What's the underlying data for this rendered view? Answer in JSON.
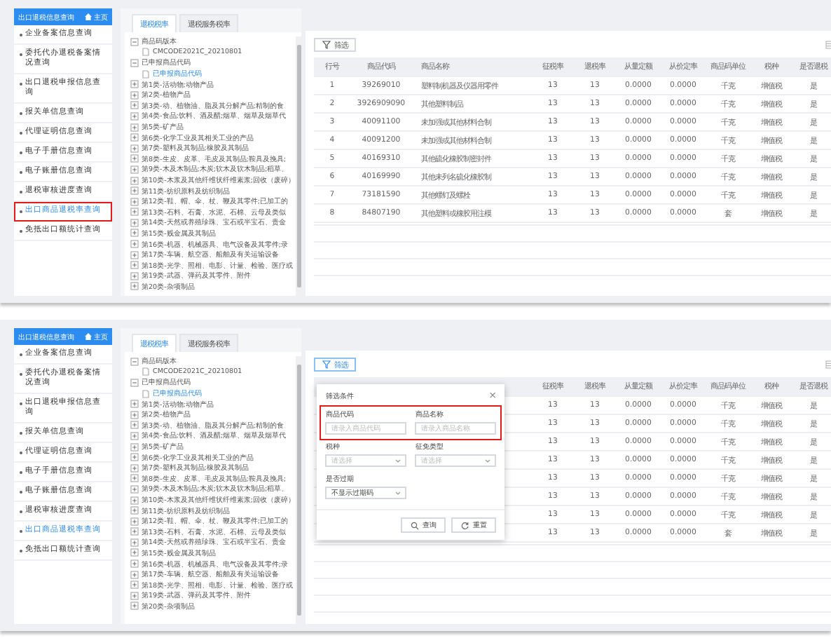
{
  "screens": [
    {
      "sidebar": {
        "title": "出口退税信息查询",
        "home_button": "主页",
        "items": [
          {
            "label": "企业备案信息查询",
            "selected": false,
            "highlighted": false
          },
          {
            "label": "委托代办退税备案情况查询",
            "selected": false,
            "highlighted": false
          },
          {
            "label": "出口退税申报信息查询",
            "selected": false,
            "highlighted": false
          },
          {
            "label": "报关单信息查询",
            "selected": false,
            "highlighted": false
          },
          {
            "label": "代理证明信息查询",
            "selected": false,
            "highlighted": false
          },
          {
            "label": "电子手册信息查询",
            "selected": false,
            "highlighted": false
          },
          {
            "label": "电子账册信息查询",
            "selected": false,
            "highlighted": false
          },
          {
            "label": "退税审核进度查询",
            "selected": false,
            "highlighted": false
          },
          {
            "label": "出口商品退税率查询",
            "selected": true,
            "highlighted": true
          },
          {
            "label": "免抵出口额统计查询",
            "selected": false,
            "highlighted": false
          }
        ]
      },
      "tabs": [
        {
          "label": "退税税率",
          "selected": true
        },
        {
          "label": "退税服务税率",
          "selected": false
        }
      ],
      "tree": [
        {
          "label": "商品码版本",
          "expanded": true,
          "selected": false,
          "children": [
            {
              "label": "CMCODE2021C_20210801",
              "selected": false
            }
          ]
        },
        {
          "label": "已申报商品代码",
          "expanded": true,
          "selected": false,
          "children": [
            {
              "label": "已申报商品代码",
              "selected": true
            }
          ]
        },
        {
          "label": "第1类-活动物;动物产品",
          "expanded": false,
          "selected": false
        },
        {
          "label": "第2类-植物产品",
          "expanded": false,
          "selected": false
        },
        {
          "label": "第3类-动、植物油、脂及其分解产品;精制的食",
          "expanded": false,
          "selected": false
        },
        {
          "label": "第4类-食品;饮料、酒及醋;烟草、烟草及烟草代",
          "expanded": false,
          "selected": false
        },
        {
          "label": "第5类-矿产品",
          "expanded": false,
          "selected": false
        },
        {
          "label": "第6类-化学工业及其相关工业的产品",
          "expanded": false,
          "selected": false
        },
        {
          "label": "第7类-塑料及其制品;橡胶及其制品",
          "expanded": false,
          "selected": false
        },
        {
          "label": "第8类-生皮、皮革、毛皮及其制品;鞍具及挽具;",
          "expanded": false,
          "selected": false
        },
        {
          "label": "第9类-木及木制品;木炭;软木及软木制品;稻草、",
          "expanded": false,
          "selected": false
        },
        {
          "label": "第10类-木浆及其他纤维状纤维素浆;回收（废碎）",
          "expanded": false,
          "selected": false
        },
        {
          "label": "第11类-纺织原料及纺织制品",
          "expanded": false,
          "selected": false
        },
        {
          "label": "第12类-鞋、帽、伞、杖、鞭及其零件;已加工的",
          "expanded": false,
          "selected": false
        },
        {
          "label": "第13类-石料、石膏、水泥、石棉、云母及类似",
          "expanded": false,
          "selected": false
        },
        {
          "label": "第14类-天然或养殖珍珠、宝石或半宝石、贵金",
          "expanded": false,
          "selected": false
        },
        {
          "label": "第15类-贱金属及其制品",
          "expanded": false,
          "selected": false
        },
        {
          "label": "第16类-机器、机械器具、电气设备及其零件;录",
          "expanded": false,
          "selected": false
        },
        {
          "label": "第17类-车辆、航空器、船舶及有关运输设备",
          "expanded": false,
          "selected": false
        },
        {
          "label": "第18类-光学、照相、电影、计量、检验、医疗或",
          "expanded": false,
          "selected": false
        },
        {
          "label": "第19类-武器、弹药及其零件、附件",
          "expanded": false,
          "selected": false
        },
        {
          "label": "第20类-杂项制品",
          "expanded": false,
          "selected": false
        }
      ],
      "filter_button": "筛选",
      "table": {
        "columns": [
          "行号",
          "商品代码",
          "商品名称",
          "征税率",
          "退税率",
          "从量定额",
          "从价定率",
          "商品码单位",
          "税种",
          "是否退税"
        ],
        "rows": [
          [
            "1",
            "39269010",
            "塑料制机器及仪器用零件",
            "13",
            "13",
            "0.0000",
            "0.0000",
            "千克",
            "增值税",
            "是"
          ],
          [
            "2",
            "3926909090",
            "其他塑料制品",
            "13",
            "13",
            "0.0000",
            "0.0000",
            "千克",
            "增值税",
            "是"
          ],
          [
            "3",
            "40091100",
            "未加强或其他材料合制",
            "13",
            "13",
            "0.0000",
            "0.0000",
            "千克",
            "增值税",
            "是"
          ],
          [
            "4",
            "40091200",
            "未加强或其他材料合制",
            "13",
            "13",
            "0.0000",
            "0.0000",
            "千克",
            "增值税",
            "是"
          ],
          [
            "5",
            "40169310",
            "其他硫化橡胶制密封件",
            "13",
            "13",
            "0.0000",
            "0.0000",
            "千克",
            "增值税",
            "是"
          ],
          [
            "6",
            "40169990",
            "其他未列名硫化橡胶制",
            "13",
            "13",
            "0.0000",
            "0.0000",
            "千克",
            "增值税",
            "是"
          ],
          [
            "7",
            "73181590",
            "其他螺钉及螺栓",
            "13",
            "13",
            "0.0000",
            "0.0000",
            "千克",
            "增值税",
            "是"
          ],
          [
            "8",
            "84807190",
            "其他塑料或橡胶用注模",
            "13",
            "13",
            "0.0000",
            "0.0000",
            "套",
            "增值税",
            "是"
          ]
        ]
      }
    },
    {
      "sidebar": {
        "title": "出口退税信息查询",
        "home_button": "主页",
        "items": [
          {
            "label": "企业备案信息查询",
            "selected": false,
            "highlighted": false
          },
          {
            "label": "委托代办退税备案情况查询",
            "selected": false,
            "highlighted": false
          },
          {
            "label": "出口退税申报信息查询",
            "selected": false,
            "highlighted": false
          },
          {
            "label": "报关单信息查询",
            "selected": false,
            "highlighted": false
          },
          {
            "label": "代理证明信息查询",
            "selected": false,
            "highlighted": false
          },
          {
            "label": "电子手册信息查询",
            "selected": false,
            "highlighted": false
          },
          {
            "label": "电子账册信息查询",
            "selected": false,
            "highlighted": false
          },
          {
            "label": "退税审核进度查询",
            "selected": false,
            "highlighted": false
          },
          {
            "label": "出口商品退税率查询",
            "selected": true,
            "highlighted": false
          },
          {
            "label": "免抵出口额统计查询",
            "selected": false,
            "highlighted": false
          }
        ]
      },
      "tabs": [
        {
          "label": "退税税率",
          "selected": true
        },
        {
          "label": "退税服务税率",
          "selected": false
        }
      ],
      "tree": [
        {
          "label": "商品码版本",
          "expanded": true,
          "selected": false,
          "children": [
            {
              "label": "CMCODE2021C_20210801",
              "selected": false
            }
          ]
        },
        {
          "label": "已申报商品代码",
          "expanded": true,
          "selected": false,
          "children": [
            {
              "label": "已申报商品代码",
              "selected": true
            }
          ]
        },
        {
          "label": "第1类-活动物;动物产品",
          "expanded": false,
          "selected": false
        },
        {
          "label": "第2类-植物产品",
          "expanded": false,
          "selected": false
        },
        {
          "label": "第3类-动、植物油、脂及其分解产品;精制的食",
          "expanded": false,
          "selected": false
        },
        {
          "label": "第4类-食品;饮料、酒及醋;烟草、烟草及烟草代",
          "expanded": false,
          "selected": false
        },
        {
          "label": "第5类-矿产品",
          "expanded": false,
          "selected": false
        },
        {
          "label": "第6类-化学工业及其相关工业的产品",
          "expanded": false,
          "selected": false
        },
        {
          "label": "第7类-塑料及其制品;橡胶及其制品",
          "expanded": false,
          "selected": false
        },
        {
          "label": "第8类-生皮、皮革、毛皮及其制品;鞍具及挽具;",
          "expanded": false,
          "selected": false
        },
        {
          "label": "第9类-木及木制品;木炭;软木及软木制品;稻草、",
          "expanded": false,
          "selected": false
        },
        {
          "label": "第10类-木浆及其他纤维状纤维素浆;回收（废碎）",
          "expanded": false,
          "selected": false
        },
        {
          "label": "第11类-纺织原料及纺织制品",
          "expanded": false,
          "selected": false
        },
        {
          "label": "第12类-鞋、帽、伞、杖、鞭及其零件;已加工的",
          "expanded": false,
          "selected": false
        },
        {
          "label": "第13类-石料、石膏、水泥、石棉、云母及类似",
          "expanded": false,
          "selected": false
        },
        {
          "label": "第14类-天然或养殖珍珠、宝石或半宝石、贵金",
          "expanded": false,
          "selected": false
        },
        {
          "label": "第15类-贱金属及其制品",
          "expanded": false,
          "selected": false
        },
        {
          "label": "第16类-机器、机械器具、电气设备及其零件;录",
          "expanded": false,
          "selected": false
        },
        {
          "label": "第17类-车辆、航空器、船舶及有关运输设备",
          "expanded": false,
          "selected": false
        },
        {
          "label": "第18类-光学、照相、电影、计量、检验、医疗或",
          "expanded": false,
          "selected": false
        },
        {
          "label": "第19类-武器、弹药及其零件、附件",
          "expanded": false,
          "selected": false
        },
        {
          "label": "第20类-杂项制品",
          "expanded": false,
          "selected": false
        }
      ],
      "filter_button": "筛选",
      "table": {
        "columns": [
          "征税率",
          "退税率",
          "从量定额",
          "从价定率",
          "商品码单位",
          "税种",
          "是否退税"
        ],
        "rows": [
          [
            "13",
            "13",
            "0.0000",
            "0.0000",
            "千克",
            "增值税",
            "是"
          ],
          [
            "13",
            "13",
            "0.0000",
            "0.0000",
            "千克",
            "增值税",
            "是"
          ],
          [
            "13",
            "13",
            "0.0000",
            "0.0000",
            "千克",
            "增值税",
            "是"
          ],
          [
            "13",
            "13",
            "0.0000",
            "0.0000",
            "千克",
            "增值税",
            "是"
          ],
          [
            "13",
            "13",
            "0.0000",
            "0.0000",
            "千克",
            "增值税",
            "是"
          ],
          [
            "13",
            "13",
            "0.0000",
            "0.0000",
            "千克",
            "增值税",
            "是"
          ],
          [
            "13",
            "13",
            "0.0000",
            "0.0000",
            "千克",
            "增值税",
            "是"
          ],
          [
            "13",
            "13",
            "0.0000",
            "0.0000",
            "套",
            "增值税",
            "是"
          ]
        ]
      },
      "filter_dialog": {
        "title": "筛选条件",
        "close": "×",
        "field_rows": [
          {
            "highlighted": true,
            "fields": [
              {
                "label": "商品代码",
                "kind": "text",
                "placeholder": "请录入商品代码"
              },
              {
                "label": "商品名称",
                "kind": "text",
                "placeholder": "请录入商品名称"
              }
            ]
          },
          {
            "highlighted": false,
            "fields": [
              {
                "label": "税种",
                "kind": "select",
                "placeholder": "请选择"
              },
              {
                "label": "征免类型",
                "kind": "select",
                "placeholder": "请选择"
              }
            ]
          },
          {
            "highlighted": false,
            "fields": [
              {
                "label": "是否过期",
                "kind": "select",
                "value": "不显示过期码"
              }
            ]
          }
        ],
        "buttons": [
          {
            "label": "查询",
            "kind": "search"
          },
          {
            "label": "重置",
            "kind": "reset"
          }
        ]
      }
    }
  ]
}
